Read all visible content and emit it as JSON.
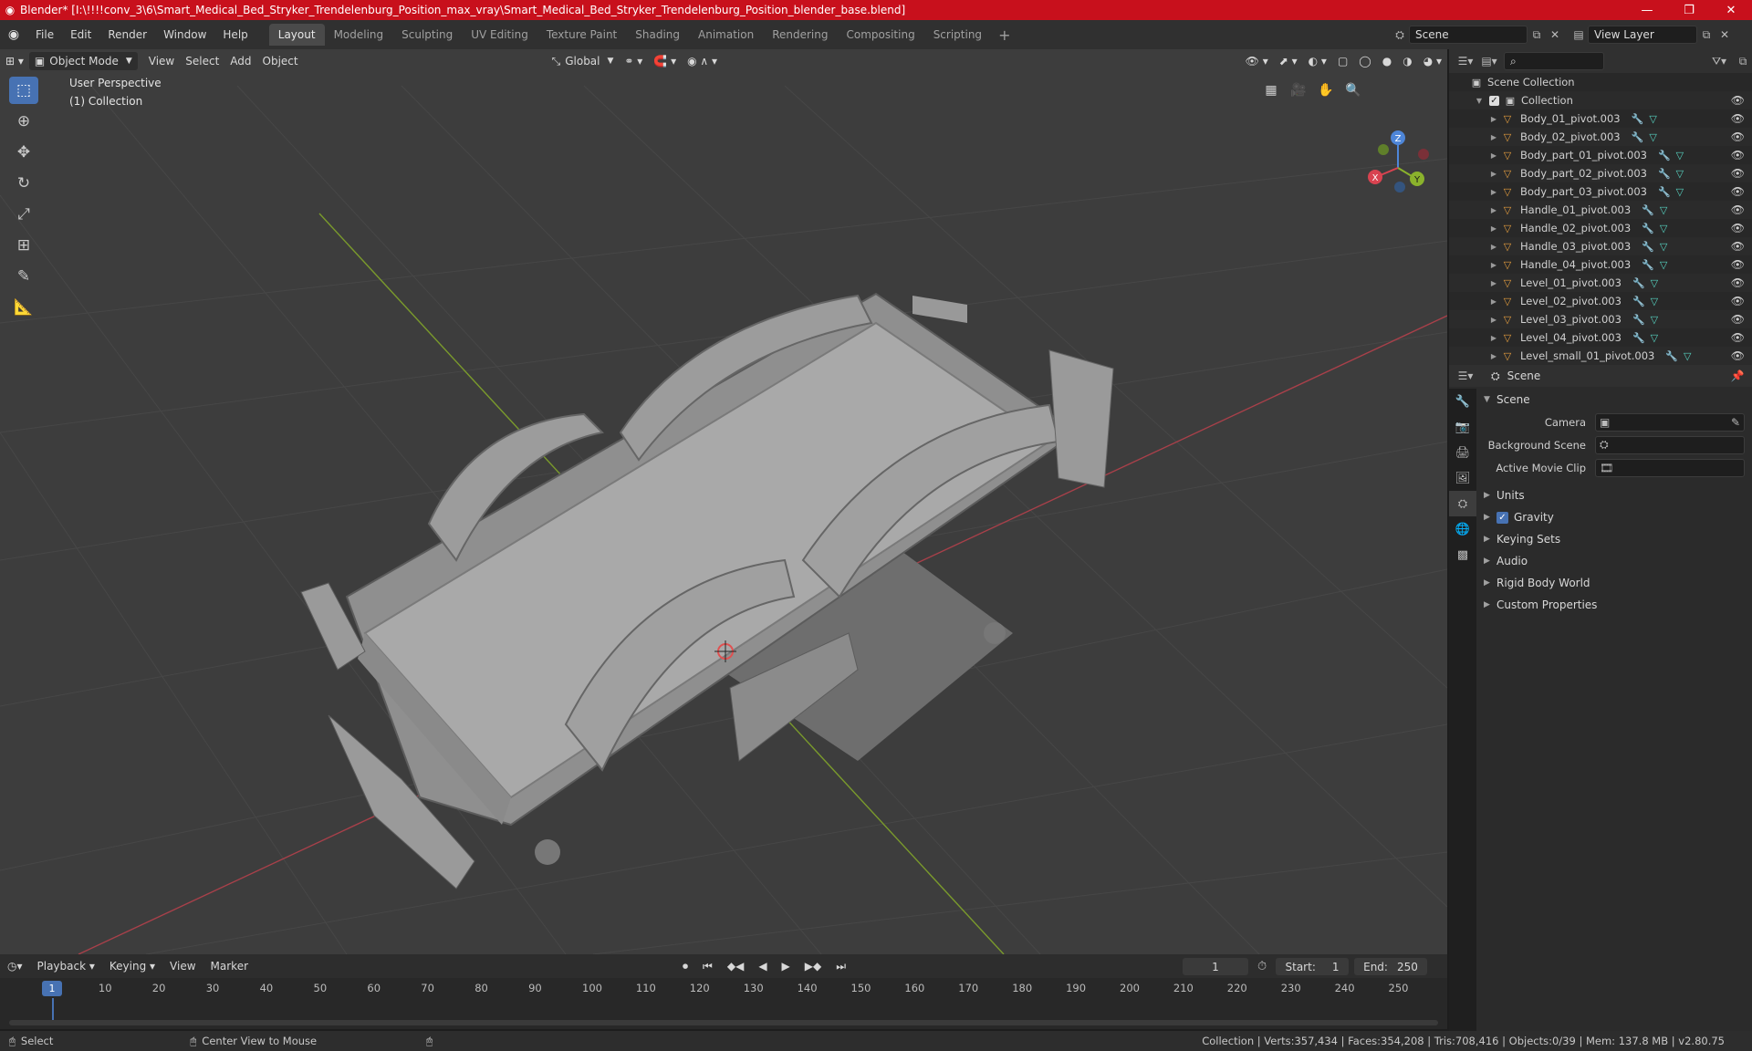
{
  "window": {
    "title": "Blender* [I:\\!!!!conv_3\\6\\Smart_Medical_Bed_Stryker_Trendelenburg_Position_max_vray\\Smart_Medical_Bed_Stryker_Trendelenburg_Position_blender_base.blend]",
    "minimize": "—",
    "maximize": "❐",
    "close": "✕"
  },
  "menu": {
    "items": [
      "File",
      "Edit",
      "Render",
      "Window",
      "Help"
    ],
    "workspaces": [
      "Layout",
      "Modeling",
      "Sculpting",
      "UV Editing",
      "Texture Paint",
      "Shading",
      "Animation",
      "Rendering",
      "Compositing",
      "Scripting"
    ],
    "active_workspace": "Layout",
    "add_tab": "+",
    "scene": "Scene",
    "view_layer": "View Layer"
  },
  "viewport": {
    "mode": "Object Mode",
    "menus": [
      "View",
      "Select",
      "Add",
      "Object"
    ],
    "orientation": "Global",
    "overlay_line1": "User Perspective",
    "overlay_line2": "(1) Collection",
    "gizmo_axes": {
      "x": "X",
      "y": "Y",
      "z": "Z"
    }
  },
  "outliner": {
    "root": "Scene Collection",
    "collection": "Collection",
    "objects": [
      "Body_01_pivot.003",
      "Body_02_pivot.003",
      "Body_part_01_pivot.003",
      "Body_part_02_pivot.003",
      "Body_part_03_pivot.003",
      "Handle_01_pivot.003",
      "Handle_02_pivot.003",
      "Handle_03_pivot.003",
      "Handle_04_pivot.003",
      "Level_01_pivot.003",
      "Level_02_pivot.003",
      "Level_03_pivot.003",
      "Level_04_pivot.003",
      "Level_small_01_pivot.003"
    ]
  },
  "properties": {
    "header": "Scene",
    "section": "Scene",
    "camera_label": "Camera",
    "background_scene_label": "Background Scene",
    "active_movie_clip_label": "Active Movie Clip",
    "subsections": [
      "Units",
      "Gravity",
      "Keying Sets",
      "Audio",
      "Rigid Body World",
      "Custom Properties"
    ]
  },
  "timeline": {
    "menus": [
      "Playback",
      "Keying",
      "View",
      "Marker"
    ],
    "current_frame": "1",
    "start_label": "Start:",
    "start": "1",
    "end_label": "End:",
    "end": "250",
    "ruler": [
      "10",
      "20",
      "30",
      "40",
      "50",
      "60",
      "70",
      "80",
      "90",
      "100",
      "110",
      "120",
      "130",
      "140",
      "150",
      "160",
      "170",
      "180",
      "190",
      "200",
      "210",
      "220",
      "230",
      "240",
      "250"
    ],
    "frame_marker": "1"
  },
  "status": {
    "select": "Select",
    "center_view": "Center View to Mouse",
    "stats": "Collection | Verts:357,434 | Faces:354,208 | Tris:708,416 | Objects:0/39 | Mem: 137.8 MB | v2.80.75"
  }
}
